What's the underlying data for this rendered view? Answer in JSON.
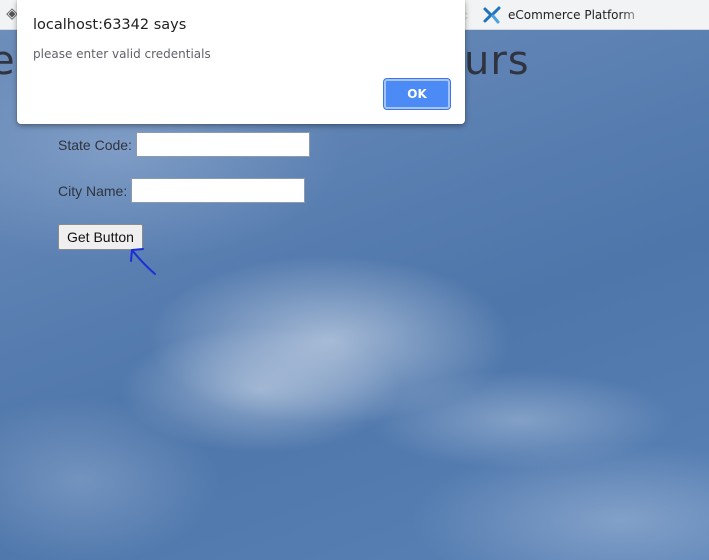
{
  "browser": {
    "tab_title": "eCommerce Platform",
    "faded_char": "c"
  },
  "page": {
    "heading_left": "er",
    "heading_right": "urs"
  },
  "form": {
    "state_label": "State Code:",
    "state_value": "",
    "city_label": "City Name:",
    "city_value": "",
    "button_label": "Get Button"
  },
  "dialog": {
    "title": "localhost:63342 says",
    "message": "please enter valid credentials",
    "ok_label": "OK"
  },
  "colors": {
    "ok_button": "#4c8bf5",
    "annotation": "#1a2fd6",
    "tab_icon": "#1e73be"
  },
  "icons": {
    "tab_left": "puzzle-icon",
    "tab_favicon": "ecommerce-logo-icon",
    "annotation": "hand-drawn-arrow-icon"
  }
}
